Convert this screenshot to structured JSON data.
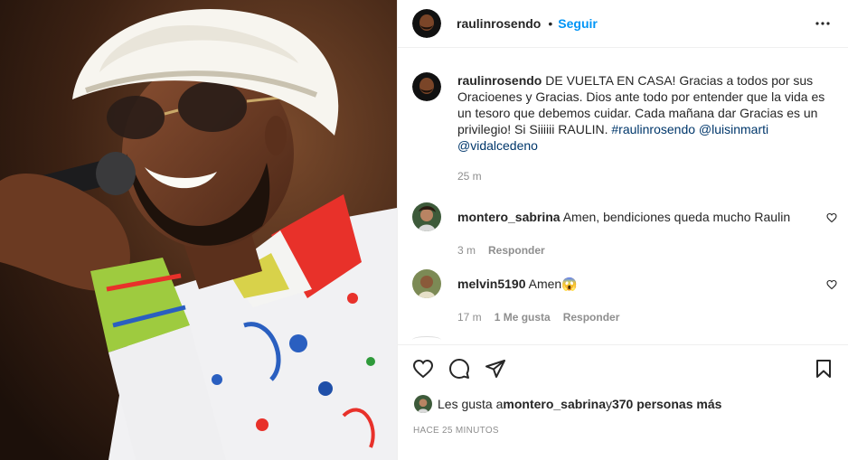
{
  "post": {
    "username": "raulinrosendo",
    "follow_label": "Seguir",
    "separator": "•",
    "more_icon": "more-horizontal-icon"
  },
  "caption": {
    "username": "raulinrosendo",
    "text": " DE VUELTA EN CASA! Gracias a todos por sus Oracioenes y Gracias. Dios ante todo por entender que la vida es un tesoro que debemos cuidar. Cada mañana dar Gracias es un privilegio! Si Siiiiii RAULIN. ",
    "hashtag": "#raulinrosendo",
    "mention1": "@luisinmarti",
    "mention2": "@vidalcedeno",
    "age": "25 m"
  },
  "comments": [
    {
      "username": "montero_sabrina",
      "text": "Amen, bendiciones queda mucho Raulin",
      "age": "3 m",
      "likes": "",
      "reply": "Responder"
    },
    {
      "username": "melvin5190",
      "text": "Amen😱",
      "age": "17 m",
      "likes": "1 Me gusta",
      "reply": "Responder"
    }
  ],
  "actions": {
    "like_icon": "heart-icon",
    "comment_icon": "comment-icon",
    "share_icon": "send-icon",
    "save_icon": "bookmark-icon"
  },
  "likes": {
    "prefix": "Les gusta a ",
    "user": "montero_sabrina",
    "middle": " y ",
    "count": "370 personas más"
  },
  "timestamp": "HACE 25 MINUTOS",
  "colors": {
    "link": "#00376b",
    "follow": "#0095f6",
    "muted": "#8e8e8e"
  }
}
